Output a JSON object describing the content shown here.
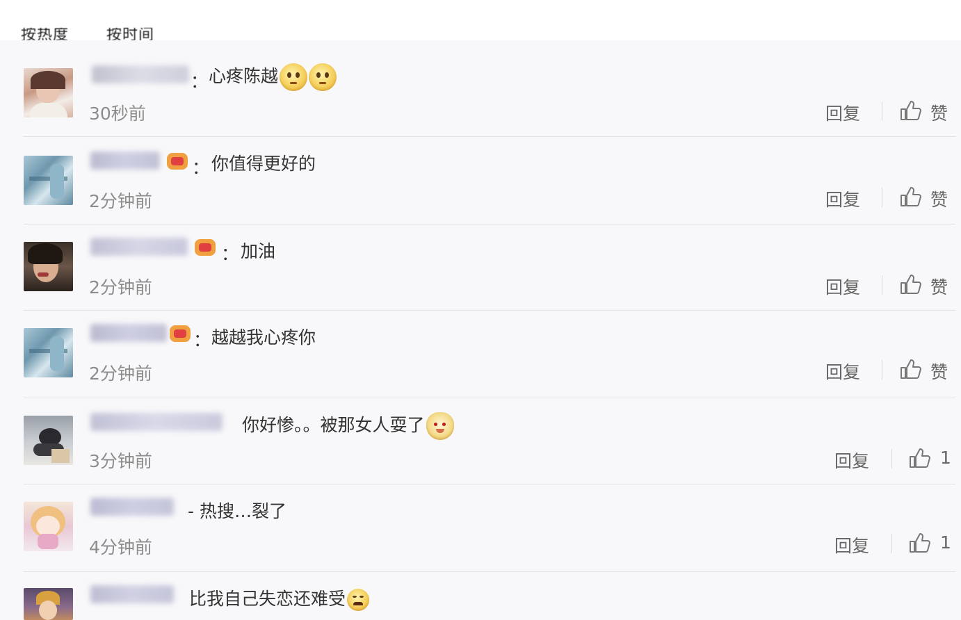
{
  "header": {
    "tabs_partial": [
      "按热度",
      "按时间"
    ]
  },
  "comments": [
    {
      "text": "心疼陈越",
      "time": "30秒前",
      "reply": "回复",
      "like": "赞",
      "colon": "："
    },
    {
      "text": "你值得更好的",
      "time": "2分钟前",
      "reply": "回复",
      "like": "赞",
      "colon": "："
    },
    {
      "text": "加油",
      "time": "2分钟前",
      "reply": "回复",
      "like": "赞",
      "colon": "："
    },
    {
      "text": "越越我心疼你",
      "time": "2分钟前",
      "reply": "回复",
      "like": "赞",
      "colon": "："
    },
    {
      "text": "你好惨。。被那女人耍了",
      "time": "3分钟前",
      "reply": "回复",
      "like": "1"
    },
    {
      "text": "- 热搜…裂了",
      "time": "4分钟前",
      "reply": "回复",
      "like": "1"
    },
    {
      "text": "比我自己失恋还难受"
    }
  ],
  "icons": [
    "avatar",
    "vip-badge-icon",
    "smile-emoji-icon",
    "dog-emoji-icon",
    "sad-emoji-icon",
    "thumbs-up-icon"
  ],
  "colors": {
    "panel": "#f8f8fa",
    "text": "#333333",
    "meta": "#8c8c8c",
    "action": "#666666",
    "divider": "#e3e3e6"
  }
}
